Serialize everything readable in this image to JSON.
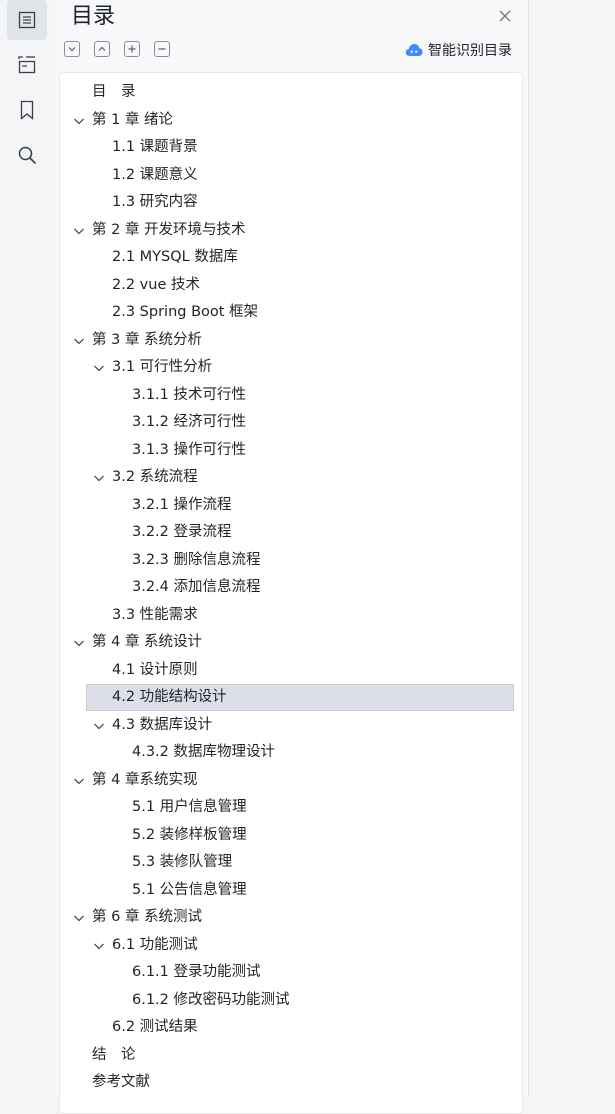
{
  "rail": {
    "items": [
      {
        "icon": "outline-icon",
        "active": true
      },
      {
        "icon": "thumbnail-icon",
        "active": false
      },
      {
        "icon": "bookmark-icon",
        "active": false
      },
      {
        "icon": "search-icon",
        "active": false
      }
    ]
  },
  "panel": {
    "title": "目录",
    "smart_label": "智能识别目录",
    "tools": [
      "expand-all",
      "collapse-all",
      "add",
      "remove"
    ]
  },
  "toc": [
    {
      "label": "目　录",
      "level": 0,
      "toggle": false
    },
    {
      "label": "第 1 章  绪论",
      "level": 0,
      "toggle": true
    },
    {
      "label": "1.1  课题背景",
      "level": 1,
      "toggle": false
    },
    {
      "label": "1.2  课题意义",
      "level": 1,
      "toggle": false
    },
    {
      "label": "1.3  研究内容",
      "level": 1,
      "toggle": false
    },
    {
      "label": "第 2 章  开发环境与技术",
      "level": 0,
      "toggle": true
    },
    {
      "label": "2.1 MYSQL 数据库",
      "level": 1,
      "toggle": false
    },
    {
      "label": "2.2 vue 技术",
      "level": 1,
      "toggle": false
    },
    {
      "label": "2.3 Spring Boot 框架",
      "level": 1,
      "toggle": false
    },
    {
      "label": "第 3 章  系统分析",
      "level": 0,
      "toggle": true
    },
    {
      "label": "3.1  可行性分析",
      "level": 1,
      "toggle": true
    },
    {
      "label": "3.1.1  技术可行性",
      "level": 2,
      "toggle": false
    },
    {
      "label": "3.1.2  经济可行性",
      "level": 2,
      "toggle": false
    },
    {
      "label": "3.1.3  操作可行性",
      "level": 2,
      "toggle": false
    },
    {
      "label": "3.2  系统流程",
      "level": 1,
      "toggle": true
    },
    {
      "label": "3.2.1  操作流程",
      "level": 2,
      "toggle": false
    },
    {
      "label": "3.2.2  登录流程",
      "level": 2,
      "toggle": false
    },
    {
      "label": "3.2.3  删除信息流程",
      "level": 2,
      "toggle": false
    },
    {
      "label": "3.2.4  添加信息流程",
      "level": 2,
      "toggle": false
    },
    {
      "label": "3.3  性能需求",
      "level": 1,
      "toggle": false
    },
    {
      "label": "第 4 章  系统设计",
      "level": 0,
      "toggle": true
    },
    {
      "label": "4.1  设计原则",
      "level": 1,
      "toggle": false
    },
    {
      "label": "4.2  功能结构设计",
      "level": 1,
      "toggle": false,
      "selected": true
    },
    {
      "label": "4.3  数据库设计",
      "level": 1,
      "toggle": true
    },
    {
      "label": "4.3.2  数据库物理设计",
      "level": 2,
      "toggle": false
    },
    {
      "label": "第 4 章系统实现",
      "level": 0,
      "toggle": true
    },
    {
      "label": "5.1 用户信息管理",
      "level": 2,
      "toggle": false
    },
    {
      "label": "5.2  装修样板管理",
      "level": 2,
      "toggle": false
    },
    {
      "label": "5.3 装修队管理",
      "level": 2,
      "toggle": false
    },
    {
      "label": "5.1 公告信息管理",
      "level": 2,
      "toggle": false
    },
    {
      "label": "第 6 章  系统测试",
      "level": 0,
      "toggle": true
    },
    {
      "label": "6.1  功能测试",
      "level": 1,
      "toggle": true
    },
    {
      "label": "6.1.1  登录功能测试",
      "level": 2,
      "toggle": false
    },
    {
      "label": "6.1.2  修改密码功能测试",
      "level": 2,
      "toggle": false
    },
    {
      "label": "6.2  测试结果",
      "level": 1,
      "toggle": false
    },
    {
      "label": "结　论",
      "level": 0,
      "toggle": false
    },
    {
      "label": "参考文献",
      "level": 0,
      "toggle": false
    }
  ],
  "colors": {
    "accent": "#3d8bff",
    "selected_bg": "#dcdfe6"
  }
}
